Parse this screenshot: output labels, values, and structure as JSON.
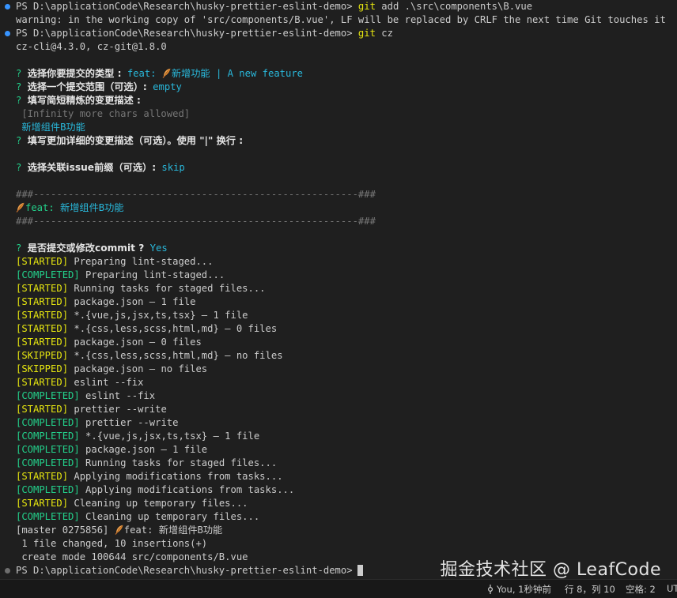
{
  "terminal": {
    "lines": [
      {
        "dot": "blue",
        "segs": [
          {
            "c": "c-default",
            "t": "PS D:\\applicationCode\\Research\\husky-prettier-eslint-demo> "
          },
          {
            "c": "c-yellow",
            "t": "git"
          },
          {
            "c": "c-default",
            "t": " add .\\src\\components\\B.vue"
          }
        ]
      },
      {
        "segs": [
          {
            "c": "c-default",
            "t": "warning: in the working copy of 'src/components/B.vue', LF will be replaced by CRLF the next time Git touches it"
          }
        ]
      },
      {
        "dot": "blue",
        "segs": [
          {
            "c": "c-default",
            "t": "PS D:\\applicationCode\\Research\\husky-prettier-eslint-demo> "
          },
          {
            "c": "c-yellow",
            "t": "git"
          },
          {
            "c": "c-default",
            "t": " cz"
          }
        ]
      },
      {
        "segs": [
          {
            "c": "c-default",
            "t": "cz-cli@4.3.0, cz-git@1.8.0"
          }
        ]
      },
      {
        "segs": []
      },
      {
        "segs": [
          {
            "c": "c-green-q",
            "t": "? "
          },
          {
            "c": "c-bold",
            "t": "选择你要提交的类型 :"
          },
          {
            "c": "c-cyan",
            "t": " feat: "
          },
          {
            "c": "icon",
            "t": ""
          },
          {
            "c": "c-cyan",
            "t": "新增功能 | A new feature"
          }
        ]
      },
      {
        "segs": [
          {
            "c": "c-green-q",
            "t": "? "
          },
          {
            "c": "c-bold",
            "t": "选择一个提交范围（可选）:"
          },
          {
            "c": "c-cyan",
            "t": " empty"
          }
        ]
      },
      {
        "segs": [
          {
            "c": "c-green-q",
            "t": "? "
          },
          {
            "c": "c-bold",
            "t": "填写简短精炼的变更描述 :"
          }
        ]
      },
      {
        "segs": [
          {
            "c": "c-gray",
            "t": " [Infinity more chars allowed]"
          }
        ]
      },
      {
        "segs": [
          {
            "c": "c-cyan",
            "t": " 新增组件B功能"
          }
        ]
      },
      {
        "segs": [
          {
            "c": "c-green-q",
            "t": "? "
          },
          {
            "c": "c-bold",
            "t": "填写更加详细的变更描述（可选）。使用 \"|\" 换行 :"
          }
        ]
      },
      {
        "segs": []
      },
      {
        "segs": [
          {
            "c": "c-green-q",
            "t": "? "
          },
          {
            "c": "c-bold",
            "t": "选择关联issue前缀（可选）:"
          },
          {
            "c": "c-cyan",
            "t": " skip"
          }
        ]
      },
      {
        "segs": []
      },
      {
        "segs": [
          {
            "c": "c-divider",
            "t": "###--------------------------------------------------------###"
          }
        ]
      },
      {
        "segs": [
          {
            "c": "icon",
            "t": ""
          },
          {
            "c": "c-green",
            "t": "feat: "
          },
          {
            "c": "c-cyan",
            "t": "新增组件B功能"
          }
        ]
      },
      {
        "segs": [
          {
            "c": "c-divider",
            "t": "###--------------------------------------------------------###"
          }
        ]
      },
      {
        "segs": []
      },
      {
        "segs": [
          {
            "c": "c-green-q",
            "t": "? "
          },
          {
            "c": "c-bold",
            "t": "是否提交或修改commit ?"
          },
          {
            "c": "c-cyan",
            "t": " Yes"
          }
        ]
      },
      {
        "segs": [
          {
            "c": "c-yellow",
            "t": "[STARTED]"
          },
          {
            "c": "c-default",
            "t": " Preparing lint-staged..."
          }
        ]
      },
      {
        "segs": [
          {
            "c": "c-green",
            "t": "[COMPLETED]"
          },
          {
            "c": "c-default",
            "t": " Preparing lint-staged..."
          }
        ]
      },
      {
        "segs": [
          {
            "c": "c-yellow",
            "t": "[STARTED]"
          },
          {
            "c": "c-default",
            "t": " Running tasks for staged files..."
          }
        ]
      },
      {
        "segs": [
          {
            "c": "c-yellow",
            "t": "[STARTED]"
          },
          {
            "c": "c-default",
            "t": " package.json — 1 file"
          }
        ]
      },
      {
        "segs": [
          {
            "c": "c-yellow",
            "t": "[STARTED]"
          },
          {
            "c": "c-default",
            "t": " *.{vue,js,jsx,ts,tsx} — 1 file"
          }
        ]
      },
      {
        "segs": [
          {
            "c": "c-yellow",
            "t": "[STARTED]"
          },
          {
            "c": "c-default",
            "t": " *.{css,less,scss,html,md} — 0 files"
          }
        ]
      },
      {
        "segs": [
          {
            "c": "c-yellow",
            "t": "[STARTED]"
          },
          {
            "c": "c-default",
            "t": " package.json — 0 files"
          }
        ]
      },
      {
        "segs": [
          {
            "c": "c-yellow",
            "t": "[SKIPPED]"
          },
          {
            "c": "c-default",
            "t": " *.{css,less,scss,html,md} — no files"
          }
        ]
      },
      {
        "segs": [
          {
            "c": "c-yellow",
            "t": "[SKIPPED]"
          },
          {
            "c": "c-default",
            "t": " package.json — no files"
          }
        ]
      },
      {
        "segs": [
          {
            "c": "c-yellow",
            "t": "[STARTED]"
          },
          {
            "c": "c-default",
            "t": " eslint --fix"
          }
        ]
      },
      {
        "segs": [
          {
            "c": "c-green",
            "t": "[COMPLETED]"
          },
          {
            "c": "c-default",
            "t": " eslint --fix"
          }
        ]
      },
      {
        "segs": [
          {
            "c": "c-yellow",
            "t": "[STARTED]"
          },
          {
            "c": "c-default",
            "t": " prettier --write"
          }
        ]
      },
      {
        "segs": [
          {
            "c": "c-green",
            "t": "[COMPLETED]"
          },
          {
            "c": "c-default",
            "t": " prettier --write"
          }
        ]
      },
      {
        "segs": [
          {
            "c": "c-green",
            "t": "[COMPLETED]"
          },
          {
            "c": "c-default",
            "t": " *.{vue,js,jsx,ts,tsx} — 1 file"
          }
        ]
      },
      {
        "segs": [
          {
            "c": "c-green",
            "t": "[COMPLETED]"
          },
          {
            "c": "c-default",
            "t": " package.json — 1 file"
          }
        ]
      },
      {
        "segs": [
          {
            "c": "c-green",
            "t": "[COMPLETED]"
          },
          {
            "c": "c-default",
            "t": " Running tasks for staged files..."
          }
        ]
      },
      {
        "segs": [
          {
            "c": "c-yellow",
            "t": "[STARTED]"
          },
          {
            "c": "c-default",
            "t": " Applying modifications from tasks..."
          }
        ]
      },
      {
        "segs": [
          {
            "c": "c-green",
            "t": "[COMPLETED]"
          },
          {
            "c": "c-default",
            "t": " Applying modifications from tasks..."
          }
        ]
      },
      {
        "segs": [
          {
            "c": "c-yellow",
            "t": "[STARTED]"
          },
          {
            "c": "c-default",
            "t": " Cleaning up temporary files..."
          }
        ]
      },
      {
        "segs": [
          {
            "c": "c-green",
            "t": "[COMPLETED]"
          },
          {
            "c": "c-default",
            "t": " Cleaning up temporary files..."
          }
        ]
      },
      {
        "segs": [
          {
            "c": "c-default",
            "t": "[master 0275856] "
          },
          {
            "c": "icon",
            "t": ""
          },
          {
            "c": "c-default",
            "t": "feat: 新增组件B功能"
          }
        ]
      },
      {
        "segs": [
          {
            "c": "c-default",
            "t": " 1 file changed, 10 insertions(+)"
          }
        ]
      },
      {
        "segs": [
          {
            "c": "c-default",
            "t": " create mode 100644 src/components/B.vue"
          }
        ]
      },
      {
        "dot": "gray",
        "cursor": true,
        "segs": [
          {
            "c": "c-default",
            "t": "PS D:\\applicationCode\\Research\\husky-prettier-eslint-demo>"
          }
        ]
      }
    ]
  },
  "watermark": "掘金技术社区 @ LeafCode",
  "statusbar": {
    "git_blame": "You, 1秒钟前",
    "cursor_pos": "行 8，列 10",
    "indent": "空格: 2",
    "encoding": "UT"
  },
  "colors": {
    "background": "#1f1f1f",
    "started": "#e5e510",
    "completed": "#23d18b",
    "answer": "#29b8db"
  },
  "icons": {
    "feat_icon": "feather-icon",
    "git_icon": "git-commit-icon"
  }
}
